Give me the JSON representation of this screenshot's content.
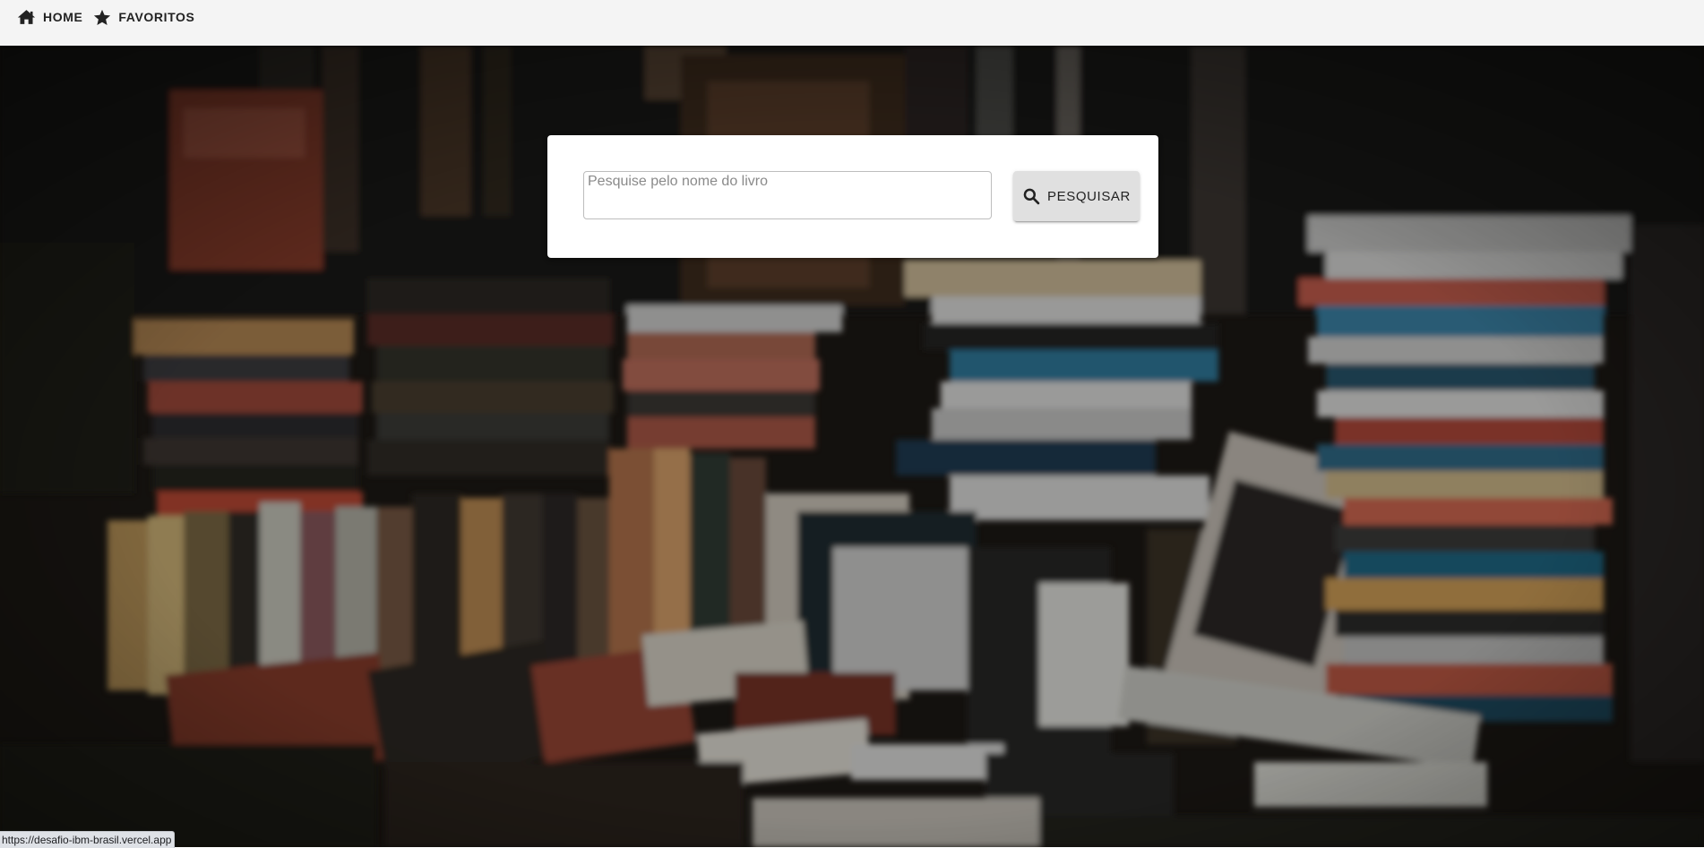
{
  "nav": {
    "home_label": "HOME",
    "home_icon": "home-icon",
    "favorites_label": "FAVORITOS",
    "favorites_icon": "star-icon"
  },
  "search": {
    "placeholder": "Pesquise pelo nome do livro",
    "value": "",
    "button_label": "PESQUISAR",
    "button_icon": "search-icon"
  },
  "status_bar": {
    "url": "https://desafio-ibm-brasil.vercel.app"
  },
  "colors": {
    "topbar_background": "#f4f4f4",
    "button_background": "#e0e0e0",
    "card_background": "#ffffff"
  }
}
